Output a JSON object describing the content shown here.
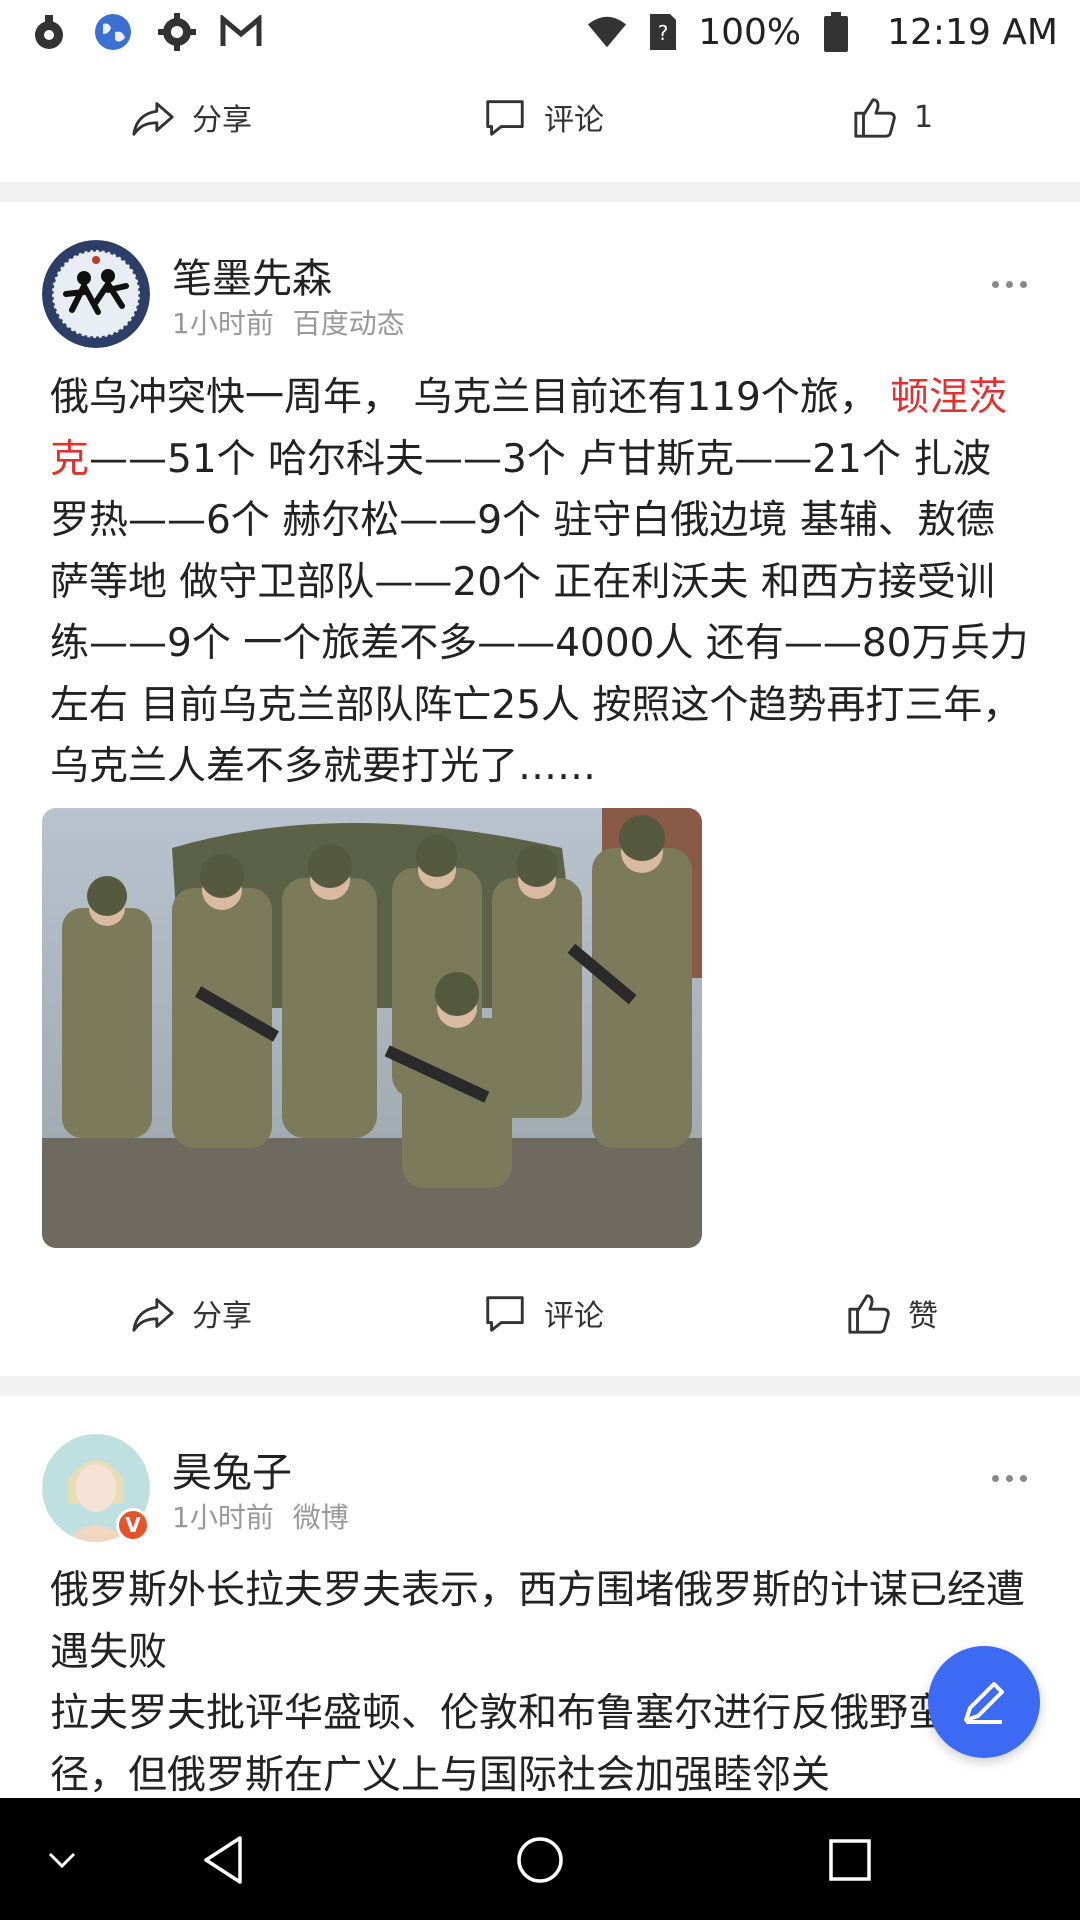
{
  "status_bar": {
    "battery": "100%",
    "time": "12:19 AM",
    "icons": [
      "camera-dot-icon",
      "globe-icon",
      "gear-icon",
      "gmail-icon",
      "wifi-icon",
      "sim-unknown-icon",
      "battery-icon"
    ]
  },
  "top_actions": {
    "share_label": "分享",
    "comment_label": "评论",
    "like_count": "1"
  },
  "post1": {
    "author": "笔墨先森",
    "time": "1小时前",
    "source": "百度动态",
    "text_before": "俄乌冲突快一周年， 乌克兰目前还有119个旅， ",
    "text_highlight": "顿涅茨克",
    "text_after": "——51个 哈尔科夫——3个 卢甘斯克——21个 扎波罗热——6个 赫尔松——9个 驻守白俄边境 基辅、敖德萨等地 做守卫部队——20个 正在利沃夫 和西方接受训练——9个 一个旅差不多——4000人 还有——80万兵力左右 目前乌克兰部队阵亡25人 按照这个趋势再打三年， 乌克兰人差不多就要打光了……",
    "actions": {
      "share_label": "分享",
      "comment_label": "评论",
      "like_label": "赞"
    }
  },
  "post2": {
    "author": "昊兔子",
    "time": "1小时前",
    "source": "微博",
    "verified_badge": "V",
    "text_line1": "俄罗斯外长拉夫罗夫表示，西方围堵俄罗斯的计谋已经遭遇失败",
    "text_line2": "拉夫罗夫批评华盛顿、伦敦和布鲁塞尔进行反俄野蛮行径，但俄罗斯在广义上与国际社会加强睦邻关"
  },
  "colors": {
    "accent_blue": "#3d6af2",
    "highlight_red": "#e0312d",
    "meta_gray": "#999999"
  }
}
